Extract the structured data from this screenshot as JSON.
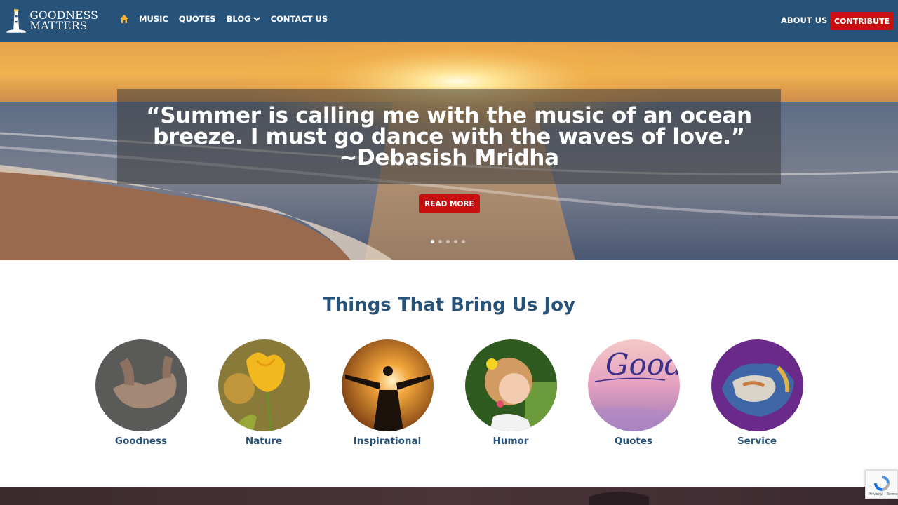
{
  "header": {
    "logo": {
      "line1": "GOODNESS",
      "line2": "MATTERS"
    },
    "nav": [
      {
        "label": "MUSIC"
      },
      {
        "label": "QUOTES"
      },
      {
        "label": "BLOG"
      },
      {
        "label": "CONTACT US"
      }
    ],
    "about_label": "ABOUT US",
    "contribute_label": "CONTRIBUTE"
  },
  "hero": {
    "quote": "“Summer is calling me with the music of an ocean breeze. I must go dance with the waves of love.” ~Debasish Mridha",
    "button_label": "READ MORE",
    "slides": 5,
    "active_slide": 1
  },
  "joy": {
    "title": "Things That Bring Us Joy",
    "categories": [
      {
        "label": "Goodness"
      },
      {
        "label": "Nature"
      },
      {
        "label": "Inspirational"
      },
      {
        "label": "Humor"
      },
      {
        "label": "Quotes"
      },
      {
        "label": "Service"
      }
    ]
  },
  "image_text": {
    "quotes_script": "Good"
  },
  "recaptcha": {
    "text": "Privacy - Terms"
  },
  "colors": {
    "header": "#27527a",
    "accent": "#c81010",
    "title": "#27527a"
  }
}
